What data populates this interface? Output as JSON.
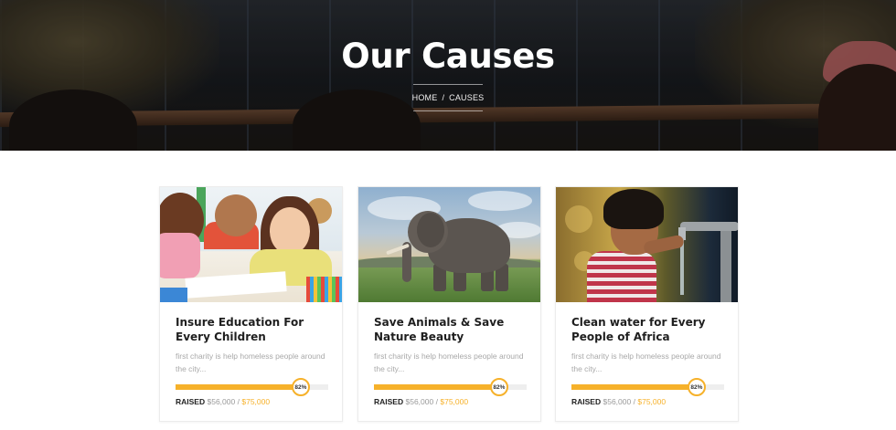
{
  "hero": {
    "title": "Our Causes",
    "breadcrumb": {
      "home": "HOME",
      "separator": "/",
      "current": "CAUSES"
    }
  },
  "colors": {
    "accent": "#f6b12a",
    "track": "#eeeeee",
    "title": "#1f1f1f",
    "muted": "#a8a8a8"
  },
  "causes": [
    {
      "title": "Insure Education For Every Children",
      "image": "children-classroom-photo",
      "description": "first charity is help homeless people around the city...",
      "progress_percent": 82,
      "progress_label": "82%",
      "raised_label": "RAISED",
      "raised": "$56,000",
      "goal_separator": "/",
      "goal": "$75,000"
    },
    {
      "title": "Save Animals & Save Nature Beauty",
      "image": "elephant-savanna-photo",
      "description": "first charity is help homeless people around the city...",
      "progress_percent": 82,
      "progress_label": "82%",
      "raised_label": "RAISED",
      "raised": "$56,000",
      "goal_separator": "/",
      "goal": "$75,000"
    },
    {
      "title": "Clean water for Every People of Africa",
      "image": "child-drinking-water-photo",
      "description": "first charity is help homeless people around the city...",
      "progress_percent": 82,
      "progress_label": "82%",
      "raised_label": "RAISED",
      "raised": "$56,000",
      "goal_separator": "/",
      "goal": "$75,000"
    }
  ]
}
